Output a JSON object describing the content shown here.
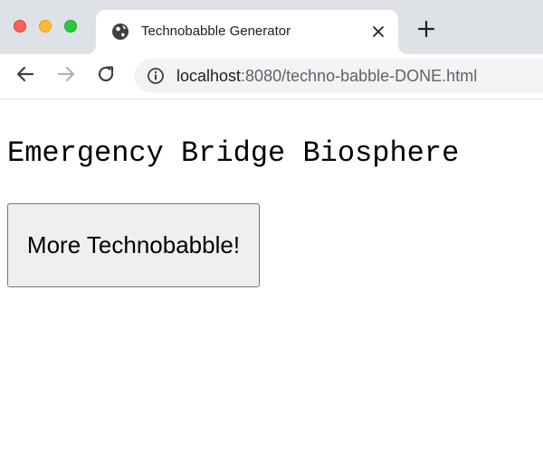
{
  "browser": {
    "tab": {
      "title": "Technobabble Generator",
      "favicon": "globe-icon"
    },
    "toolbar": {
      "back_icon": "arrow-left-icon",
      "forward_icon": "arrow-right-icon",
      "reload_icon": "reload-icon",
      "info_icon": "info-icon"
    },
    "address": {
      "host": "localhost",
      "rest": ":8080/techno-babble-DONE.html"
    },
    "new_tab_icon": "plus-icon",
    "close_icon": "close-icon",
    "window_controls": {
      "close_color": "#ff5f57",
      "minimize_color": "#febc2e",
      "zoom_color": "#28c840"
    }
  },
  "page": {
    "heading": "Emergency Bridge Biosphere",
    "button_label": "More Technobabble!"
  }
}
